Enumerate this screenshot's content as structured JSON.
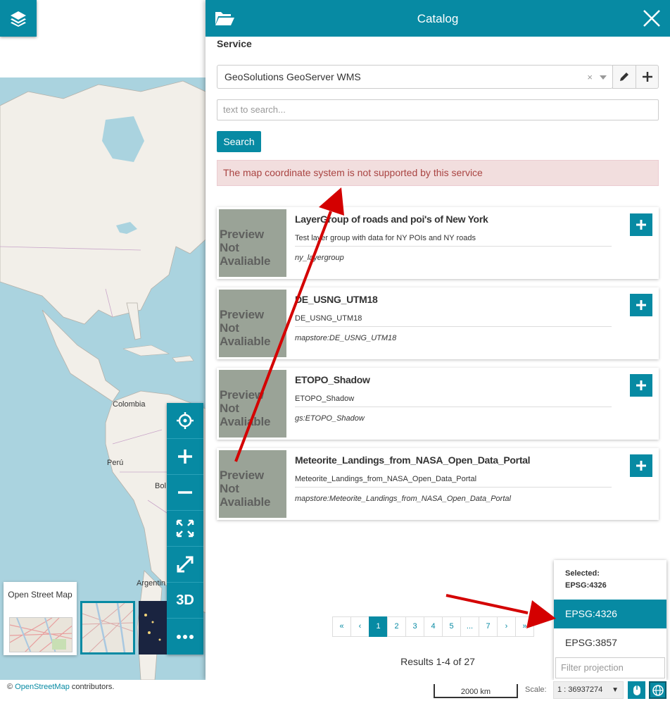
{
  "map": {
    "labels": {
      "colombia": "Colombia",
      "peru": "Perú",
      "bolivia": "Bol",
      "argentina": "Argentin"
    },
    "background_switcher": {
      "selected_title": "Open Street Map"
    }
  },
  "catalog": {
    "title": "Catalog",
    "service_label": "Service",
    "service_value": "GeoSolutions GeoServer WMS",
    "search_placeholder": "text to search...",
    "search_button": "Search",
    "alert": "The map coordinate system is not supported by this service",
    "preview_text": "Preview Not Avaliable",
    "records": [
      {
        "title": "LayerGroup of roads and poi's of New York",
        "description": "Test layer group with data for NY POIs and NY roads",
        "name": "ny_layergroup"
      },
      {
        "title": "DE_USNG_UTM18",
        "description": "DE_USNG_UTM18",
        "name": "mapstore:DE_USNG_UTM18"
      },
      {
        "title": "ETOPO_Shadow",
        "description": "ETOPO_Shadow",
        "name": "gs:ETOPO_Shadow"
      },
      {
        "title": "Meteorite_Landings_from_NASA_Open_Data_Portal",
        "description": "Meteorite_Landings_from_NASA_Open_Data_Portal",
        "name": "mapstore:Meteorite_Landings_from_NASA_Open_Data_Portal"
      }
    ],
    "pagination": [
      "«",
      "‹",
      "1",
      "2",
      "3",
      "4",
      "5",
      "...",
      "7",
      "›",
      "»"
    ],
    "active_page": "1",
    "results": "Results 1-4 of 27"
  },
  "projection": {
    "selected_label": "Selected:",
    "selected_value": "EPSG:4326",
    "options": [
      "EPSG:4326",
      "EPSG:3857"
    ],
    "filter_placeholder": "Filter projection"
  },
  "footer": {
    "attribution_prefix": "©",
    "attribution_link": "OpenStreetMap",
    "attribution_suffix": "contributors.",
    "scalebar": "2000 km",
    "scale_label": "Scale:",
    "scale_value": "1 : 36937274"
  },
  "toolbar": {
    "three_d": "3D"
  },
  "colors": {
    "primary": "#078aa3",
    "alert_bg": "#f2dede",
    "alert_text": "#a94442",
    "annotation_arrow": "#d40000"
  }
}
